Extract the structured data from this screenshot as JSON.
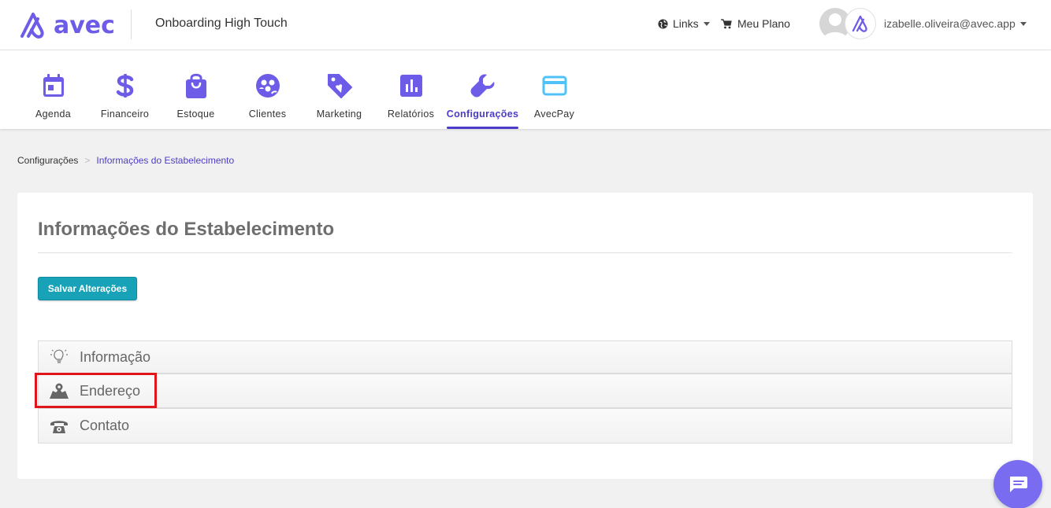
{
  "header": {
    "logo_text": "avec",
    "account_name": "Onboarding High Touch",
    "links_label": "Links",
    "plan_label": "Meu Plano",
    "user_email": "izabelle.oliveira@avec.app"
  },
  "modules": [
    {
      "label": "Agenda",
      "icon": "calendar-icon"
    },
    {
      "label": "Financeiro",
      "icon": "dollar-icon"
    },
    {
      "label": "Estoque",
      "icon": "shopping-bag-icon"
    },
    {
      "label": "Clientes",
      "icon": "clients-icon"
    },
    {
      "label": "Marketing",
      "icon": "tag-heart-icon"
    },
    {
      "label": "Relatórios",
      "icon": "bar-chart-icon"
    },
    {
      "label": "Configurações",
      "icon": "wrench-icon",
      "active": true
    },
    {
      "label": "AvecPay",
      "icon": "credit-card-icon"
    }
  ],
  "breadcrumb": {
    "root": "Configurações",
    "separator": ">",
    "current": "Informações do Estabelecimento"
  },
  "page": {
    "title": "Informações do Estabelecimento",
    "save_button": "Salvar Alterações"
  },
  "sections": [
    {
      "label": "Informação",
      "icon": "lightbulb-icon"
    },
    {
      "label": "Endereço",
      "icon": "map-pin-icon"
    },
    {
      "label": "Contato",
      "icon": "phone-icon"
    }
  ],
  "colors": {
    "brand": "#6c5ce7",
    "active": "#4b3cc9",
    "save_button": "#17a2b8",
    "avecpay_icon": "#4fc3f7",
    "highlight": "#e0161c"
  }
}
